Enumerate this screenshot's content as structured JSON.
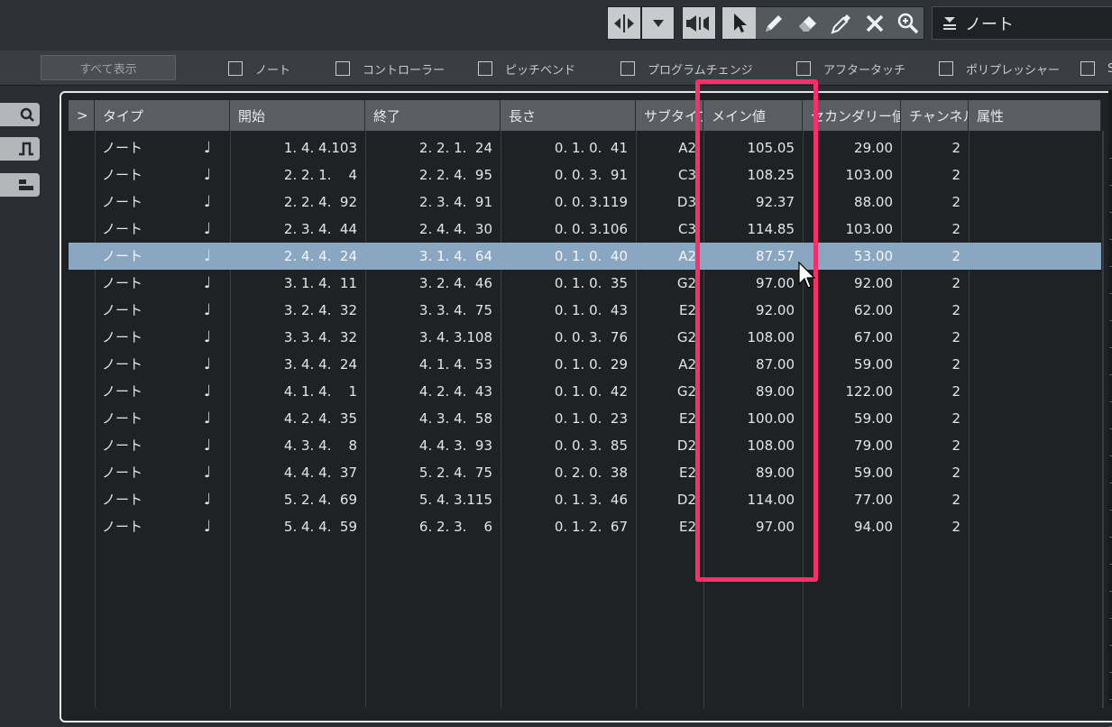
{
  "toolbar": {
    "event_type_dropdown": "ノート"
  },
  "filterbar": {
    "show_all": "すべて表示",
    "filters": [
      "ノート",
      "コントローラー",
      "ピッチベンド",
      "プログラムチェンジ",
      "アフタータッチ",
      "ポリプレッシャー",
      "S"
    ]
  },
  "list": {
    "expand": ">",
    "columns": [
      "タイプ",
      "開始",
      "終了",
      "長さ",
      "サブタイプ",
      "メイン値",
      "セカンダリー値",
      "チャンネル",
      "属性"
    ],
    "rows": [
      {
        "type": "ノート",
        "start": "1. 4. 4.103",
        "end": "2. 2. 1.  24",
        "length": "0. 1. 0.  41",
        "subtype": "A2",
        "main": "105.05",
        "secondary": "29.00",
        "channel": "2"
      },
      {
        "type": "ノート",
        "start": "2. 2. 1.    4",
        "end": "2. 2. 4.  95",
        "length": "0. 0. 3.  91",
        "subtype": "C3",
        "main": "108.25",
        "secondary": "103.00",
        "channel": "2"
      },
      {
        "type": "ノート",
        "start": "2. 2. 4.  92",
        "end": "2. 3. 4.  91",
        "length": "0. 0. 3.119",
        "subtype": "D3",
        "main": "92.37",
        "secondary": "88.00",
        "channel": "2"
      },
      {
        "type": "ノート",
        "start": "2. 3. 4.  44",
        "end": "2. 4. 4.  30",
        "length": "0. 0. 3.106",
        "subtype": "C3",
        "main": "114.85",
        "secondary": "103.00",
        "channel": "2"
      },
      {
        "type": "ノート",
        "start": "2. 4. 4.  24",
        "end": "3. 1. 4.  64",
        "length": "0. 1. 0.  40",
        "subtype": "A2",
        "main": "87.57",
        "secondary": "53.00",
        "channel": "2"
      },
      {
        "type": "ノート",
        "start": "3. 1. 4.  11",
        "end": "3. 2. 4.  46",
        "length": "0. 1. 0.  35",
        "subtype": "G2",
        "main": "97.00",
        "secondary": "92.00",
        "channel": "2"
      },
      {
        "type": "ノート",
        "start": "3. 2. 4.  32",
        "end": "3. 3. 4.  75",
        "length": "0. 1. 0.  43",
        "subtype": "E2",
        "main": "92.00",
        "secondary": "62.00",
        "channel": "2"
      },
      {
        "type": "ノート",
        "start": "3. 3. 4.  32",
        "end": "3. 4. 3.108",
        "length": "0. 0. 3.  76",
        "subtype": "G2",
        "main": "108.00",
        "secondary": "67.00",
        "channel": "2"
      },
      {
        "type": "ノート",
        "start": "3. 4. 4.  24",
        "end": "4. 1. 4.  53",
        "length": "0. 1. 0.  29",
        "subtype": "A2",
        "main": "87.00",
        "secondary": "59.00",
        "channel": "2"
      },
      {
        "type": "ノート",
        "start": "4. 1. 4.    1",
        "end": "4. 2. 4.  43",
        "length": "0. 1. 0.  42",
        "subtype": "G2",
        "main": "89.00",
        "secondary": "122.00",
        "channel": "2"
      },
      {
        "type": "ノート",
        "start": "4. 2. 4.  35",
        "end": "4. 3. 4.  58",
        "length": "0. 1. 0.  23",
        "subtype": "E2",
        "main": "100.00",
        "secondary": "59.00",
        "channel": "2"
      },
      {
        "type": "ノート",
        "start": "4. 3. 4.    8",
        "end": "4. 4. 3.  93",
        "length": "0. 0. 3.  85",
        "subtype": "D2",
        "main": "108.00",
        "secondary": "79.00",
        "channel": "2"
      },
      {
        "type": "ノート",
        "start": "4. 4. 4.  37",
        "end": "5. 2. 4.  75",
        "length": "0. 2. 0.  38",
        "subtype": "E2",
        "main": "89.00",
        "secondary": "59.00",
        "channel": "2"
      },
      {
        "type": "ノート",
        "start": "5. 2. 4.  69",
        "end": "5. 4. 3.115",
        "length": "0. 1. 3.  46",
        "subtype": "D2",
        "main": "114.00",
        "secondary": "77.00",
        "channel": "2"
      },
      {
        "type": "ノート",
        "start": "5. 4. 4.  59",
        "end": "6. 2. 3.    6",
        "length": "0. 1. 2.  67",
        "subtype": "E2",
        "main": "97.00",
        "secondary": "94.00",
        "channel": "2"
      }
    ],
    "selected_row": 4
  },
  "colors": {
    "highlight": "#ff2d6a",
    "selected_row": "#8aa7c2",
    "header": "#5a5e63"
  },
  "icons": [
    "split-icon",
    "dropdown-arrow-icon",
    "mute-icon",
    "arrow-cursor-icon",
    "pencil-icon",
    "eraser-icon",
    "eyedropper-icon",
    "close-icon",
    "zoom-icon",
    "event-type-icon",
    "quantize-icon",
    "step-icon",
    "block-icon",
    "quarter-note-icon",
    "mouse-cursor-icon"
  ]
}
